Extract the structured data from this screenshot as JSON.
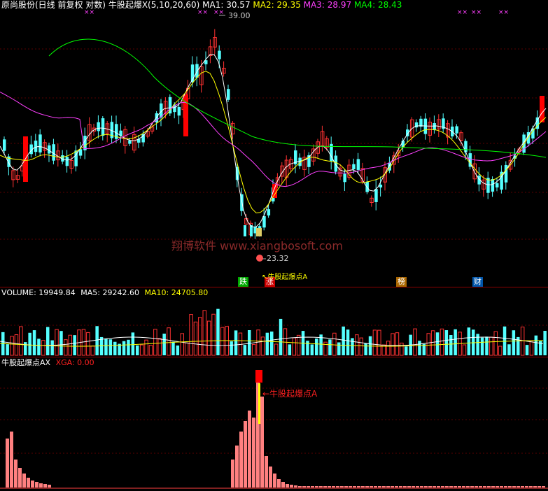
{
  "header": {
    "stock_title": "原尚股份(日线 前复权 对数)",
    "indicator": "牛股起爆X(5,10,20,60)",
    "ma": [
      {
        "label": "MA1:",
        "value": "30.57",
        "color": "#ffffff"
      },
      {
        "label": "MA2:",
        "value": "29.35",
        "color": "#ffff00"
      },
      {
        "label": "MA3:",
        "value": "28.97",
        "color": "#ff40ff"
      },
      {
        "label": "MA4:",
        "value": "28.43",
        "color": "#00ff00"
      }
    ]
  },
  "markers": {
    "high_price": "39.00",
    "low_price": "23.32",
    "watermark": "翔博软件  www.xiangbosoft.com",
    "cross_symbol": "××",
    "events": [
      {
        "text": "跌",
        "bg": "#00aa00",
        "fg": "#ffffff"
      },
      {
        "text": "涨",
        "bg": "#cc0000",
        "fg": "#ffffff"
      },
      {
        "text": "榜",
        "bg": "#aa6600",
        "fg": "#ffffff"
      },
      {
        "text": "财",
        "bg": "#0055aa",
        "fg": "#ffffff"
      }
    ],
    "arrow_label": "牛股起爆点A"
  },
  "volume": {
    "label": "VOLUME:",
    "value": "19949.84",
    "ma5_label": "MA5:",
    "ma5_value": "29242.60",
    "ma10_label": "MA10:",
    "ma10_value": "24705.80"
  },
  "bottom": {
    "label": "牛股起爆点AX",
    "xga_label": "XGA:",
    "xga_value": "0.00",
    "signal_label": "←牛股起爆点A"
  },
  "colors": {
    "up": "#ff3232",
    "down": "#54ffff",
    "ma1": "#ffffff",
    "ma2": "#ffff00",
    "ma3": "#ff40ff",
    "ma4": "#00ff00",
    "grid": "#8b0000",
    "pink": "#ff8080"
  }
}
